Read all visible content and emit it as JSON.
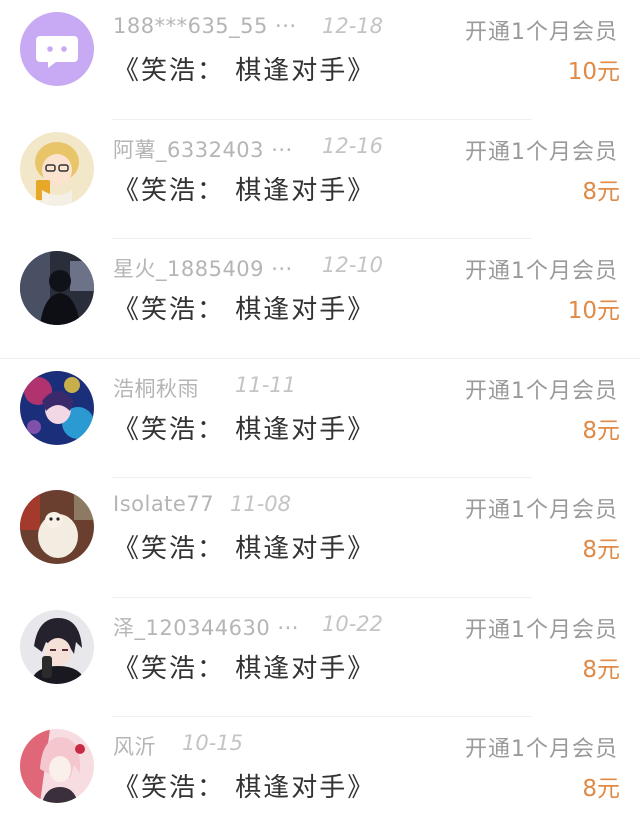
{
  "records": [
    {
      "user": "188***635_55 ···",
      "date": "12-18",
      "action": "开通1个月会员",
      "book": "《笑浩： 棋逢对手》",
      "amount": "10元",
      "avatar": "purple-chat-icon"
    },
    {
      "user": "阿薯_6332403 ···",
      "date": "12-16",
      "action": "开通1个月会员",
      "book": "《笑浩： 棋逢对手》",
      "amount": "8元",
      "avatar": "anime-blonde-glasses"
    },
    {
      "user": "星火_1885409 ···",
      "date": "12-10",
      "action": "开通1个月会员",
      "book": "《笑浩： 棋逢对手》",
      "amount": "10元",
      "avatar": "dark-silhouette"
    },
    {
      "user": "浩桐秋雨",
      "date": "11-11",
      "action": "开通1个月会员",
      "book": "《笑浩： 棋逢对手》",
      "amount": "8元",
      "avatar": "colorful-anime"
    },
    {
      "user": "Isolate77",
      "date": "11-08",
      "action": "开通1个月会员",
      "book": "《笑浩： 棋逢对手》",
      "amount": "8元",
      "avatar": "white-dog"
    },
    {
      "user": "泽_120344630 ···",
      "date": "10-22",
      "action": "开通1个月会员",
      "book": "《笑浩： 棋逢对手》",
      "amount": "8元",
      "avatar": "anime-dark-hair"
    },
    {
      "user": "风沂",
      "date": "10-15",
      "action": "开通1个月会员",
      "book": "《笑浩： 棋逢对手》",
      "amount": "8元",
      "avatar": "anime-pink-hair"
    }
  ],
  "colors": {
    "amount": "#e08a45",
    "username": "#b5b5b5",
    "date": "#c4c4c4",
    "action": "#9a9a9a",
    "title": "#333333"
  }
}
